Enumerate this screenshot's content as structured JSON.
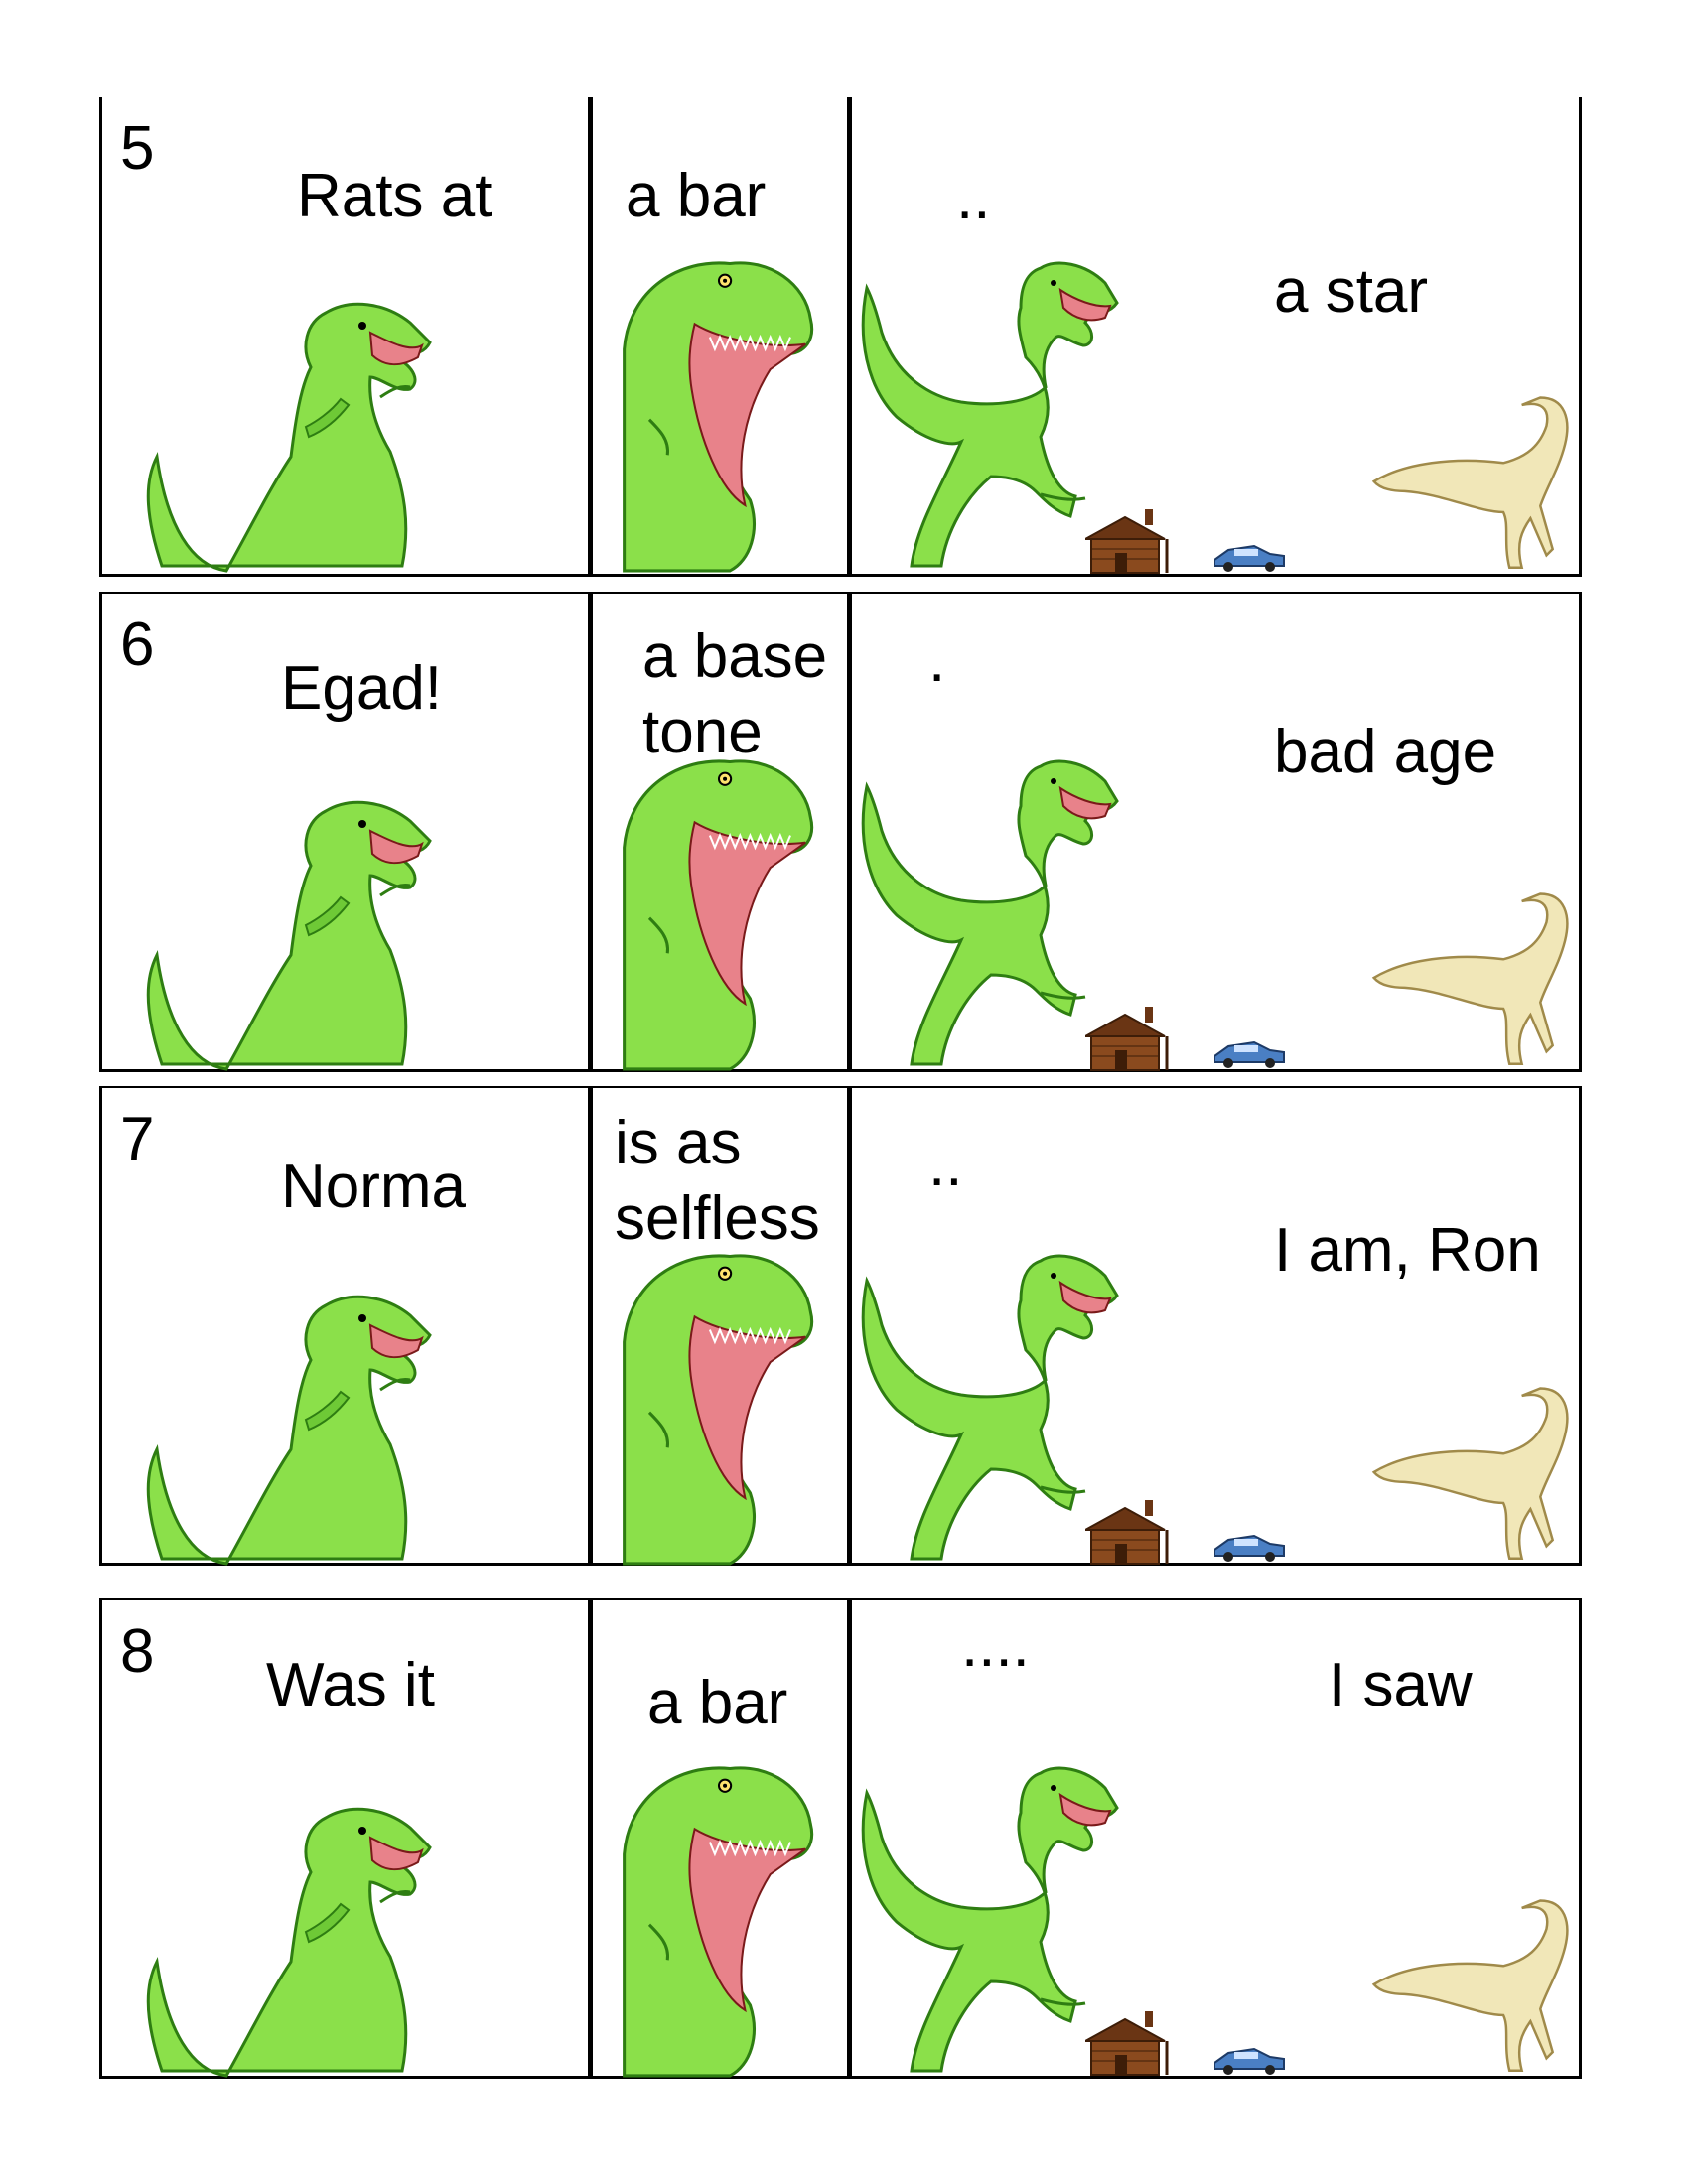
{
  "strips": [
    {
      "number": "5",
      "panel1": "Rats at",
      "panel2": "a bar",
      "panel3_dots": "..",
      "panel3_text": "a star"
    },
    {
      "number": "6",
      "panel1": "Egad!",
      "panel2": "a base\ntone",
      "panel3_dots": ".",
      "panel3_text": "bad age"
    },
    {
      "number": "7",
      "panel1": "Norma",
      "panel2": "is as\nselfless",
      "panel3_dots": "..",
      "panel3_text": "I am, Ron"
    },
    {
      "number": "8",
      "panel1": "Was it",
      "panel2": "a bar",
      "panel3_dots": "....",
      "panel3_text": "I saw"
    }
  ],
  "colors": {
    "dino_green": "#8be04a",
    "dino_outline": "#2e7d12",
    "mouth": "#e8828a",
    "raptor": "#f1e7b8",
    "cabin": "#8a4a1e",
    "car": "#4a7fc4"
  }
}
